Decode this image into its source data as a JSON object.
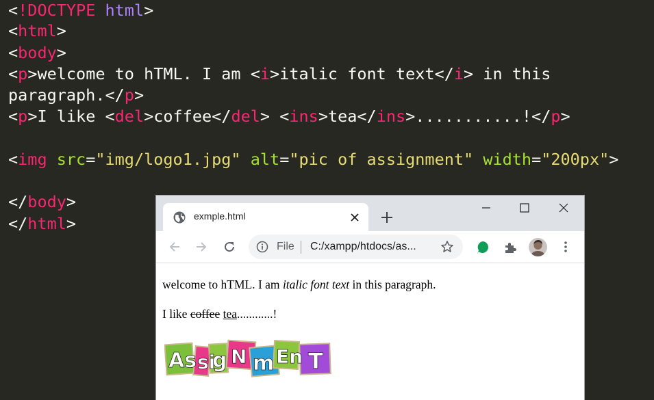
{
  "editor": {
    "lines": [
      {
        "t1": "<",
        "t2": "!DOCTYPE",
        "t3": " html",
        "t4": ">"
      },
      {
        "t1": "<",
        "t2": "html",
        "t3": ">"
      },
      {
        "t1": "<",
        "t2": "body",
        "t3": ">"
      },
      {
        "a": "<",
        "b": "p",
        "c": ">welcome to hTML. I am <",
        "d": "i",
        "e": ">italic font text</",
        "f": "i",
        "g": "> in this"
      },
      {
        "a": "paragraph.</",
        "b": "p",
        "c": ">"
      },
      {
        "a": "<",
        "b": "p",
        "c": ">I like <",
        "d": "del",
        "e": ">coffee</",
        "f": "del",
        "g": "> <",
        "h": "ins",
        "i": ">tea</",
        "j": "ins",
        "k": ">...........!</",
        "l": "p",
        "m": ">"
      },
      {
        "a": "<",
        "b": "img",
        "c": " src",
        "d": "=",
        "e": "\"img/logo1.jpg\"",
        "f": " alt",
        "g": "=",
        "h": "\"pic of assignment\"",
        "i": " width",
        "j": "=",
        "k": "\"200px\"",
        "l": ">"
      },
      {
        "a": "</",
        "b": "body",
        "c": ">"
      },
      {
        "a": "</",
        "b": "html",
        "c": ">"
      }
    ]
  },
  "browser": {
    "tab_title": "exmple.html",
    "omnibox": {
      "file_label": "File",
      "url": "C:/xampp/htdocs/as..."
    },
    "page": {
      "p1_a": "welcome to hTML. I am ",
      "p1_i": "italic font text",
      "p1_b": " in this paragraph.",
      "p2_a": "I like ",
      "p2_del": "coffee",
      "p2_sp": " ",
      "p2_ins": "tea",
      "p2_b": "............!",
      "logo_text": "AssigNmEnT"
    }
  },
  "colors": {
    "editor_bg": "#272822",
    "tag": "#f92672",
    "keyword": "#ae81ff",
    "attribute": "#a6e22e",
    "string": "#e6db74",
    "text": "#f8f8f2"
  },
  "icons": [
    "globe-icon",
    "close-icon",
    "plus-icon",
    "minimize-icon",
    "maximize-icon",
    "window-close-icon",
    "back-arrow-icon",
    "forward-arrow-icon",
    "reload-icon",
    "info-icon",
    "star-icon",
    "green-extension-icon",
    "puzzle-icon",
    "avatar",
    "menu-dots-icon"
  ]
}
